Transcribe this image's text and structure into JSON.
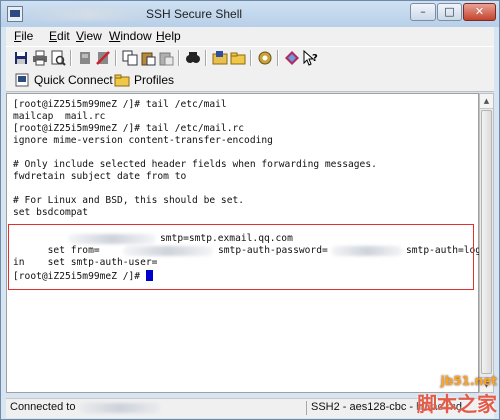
{
  "window": {
    "title": "SSH Secure Shell",
    "controls": {
      "minimize": "–",
      "maximize": "□",
      "close": "✕"
    }
  },
  "menu": {
    "file": {
      "accel": "F",
      "rest": "ile"
    },
    "edit": {
      "accel": "E",
      "rest": "dit"
    },
    "view": {
      "accel": "V",
      "rest": "iew"
    },
    "window": {
      "accel": "W",
      "rest": "indow"
    },
    "help": {
      "accel": "H",
      "rest": "elp"
    }
  },
  "toolbar": {
    "icons": [
      "save-icon",
      "print-icon",
      "print-preview-icon",
      "connect-icon",
      "disconnect-icon",
      "copy-icon",
      "paste-icon",
      "paste-special-icon",
      "find-icon",
      "file-transfer-icon",
      "new-folder-icon",
      "settings-icon",
      "profile-icon",
      "help-icon"
    ]
  },
  "quickbar": {
    "quick_connect": "Quick Connect",
    "profiles": "Profiles"
  },
  "terminal": {
    "lines": [
      "[root@iZ25i5m99meZ /]# tail /etc/mail",
      "mailcap  mail.rc",
      "[root@iZ25i5m99meZ /]# tail /etc/mail.rc",
      "ignore mime-version content-transfer-encoding",
      "",
      "# Only include selected header fields when forwarding messages.",
      "fwdretain subject date from to",
      "",
      "# For Linux and BSD, this should be set.",
      "set bsdcompat",
      "",
      "set from=",
      "set smtp-auth-user=",
      "in",
      "[root@iZ25i5m99meZ /]# "
    ],
    "line_from_suffix": "smtp=smtp.exmail.qq.com",
    "line_auth_mid": "smtp-auth-password=",
    "line_auth_suffix": "smtp-auth=log"
  },
  "status": {
    "connected": "Connected to",
    "cipher": "SSH2 - aes128-cbc - hmac-md"
  },
  "watermark": {
    "site": "jb51.net",
    "brand": "脚本之家"
  },
  "colors": {
    "highlight_box": "#e23030",
    "cursor": "#0000cc"
  }
}
